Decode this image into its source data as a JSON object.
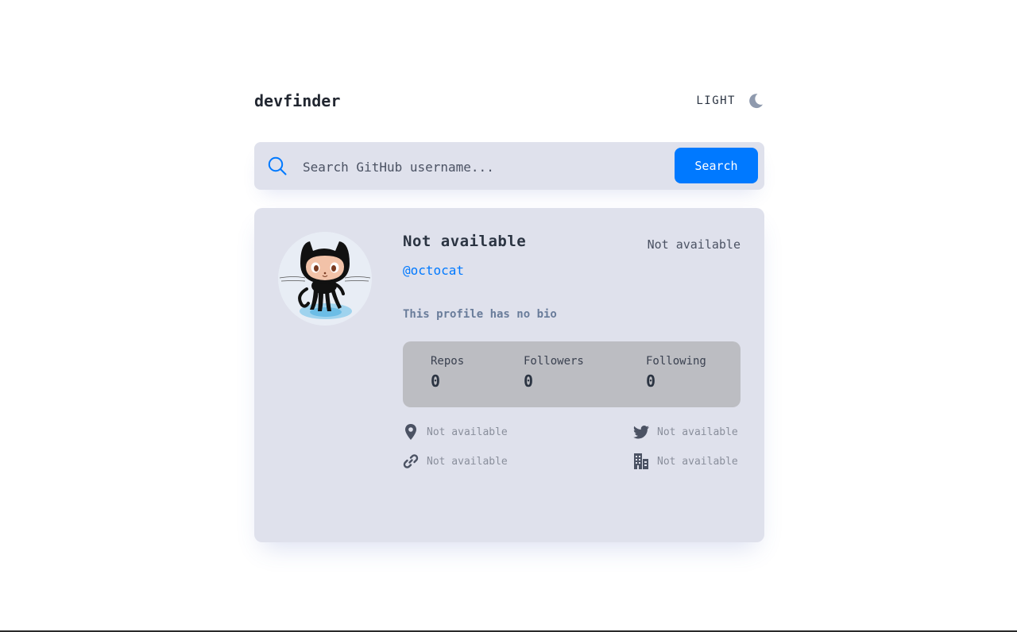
{
  "app": {
    "logo": "devfinder",
    "theme_label": "LIGHT",
    "theme_icon": "moon-icon"
  },
  "search": {
    "placeholder": "Search GitHub username...",
    "button_label": "Search",
    "icon": "search-icon"
  },
  "profile": {
    "name": "Not available",
    "joined": "Not available",
    "login": "@octocat",
    "bio": "This profile has no bio",
    "avatar_icon": "octocat-avatar"
  },
  "stats": [
    {
      "label": "Repos",
      "value": "0"
    },
    {
      "label": "Followers",
      "value": "0"
    },
    {
      "label": "Following",
      "value": "0"
    }
  ],
  "links": {
    "location": {
      "icon": "location-pin-icon",
      "text": "Not available"
    },
    "twitter": {
      "icon": "twitter-icon",
      "text": "Not available"
    },
    "website": {
      "icon": "link-icon",
      "text": "Not available"
    },
    "company": {
      "icon": "building-icon",
      "text": "Not available"
    }
  },
  "colors": {
    "accent": "#0079ff",
    "card_bg": "#dfe1ec",
    "stats_bg": "#bcbdc2",
    "text": "#2b3442",
    "muted": "#8a8f9c"
  }
}
